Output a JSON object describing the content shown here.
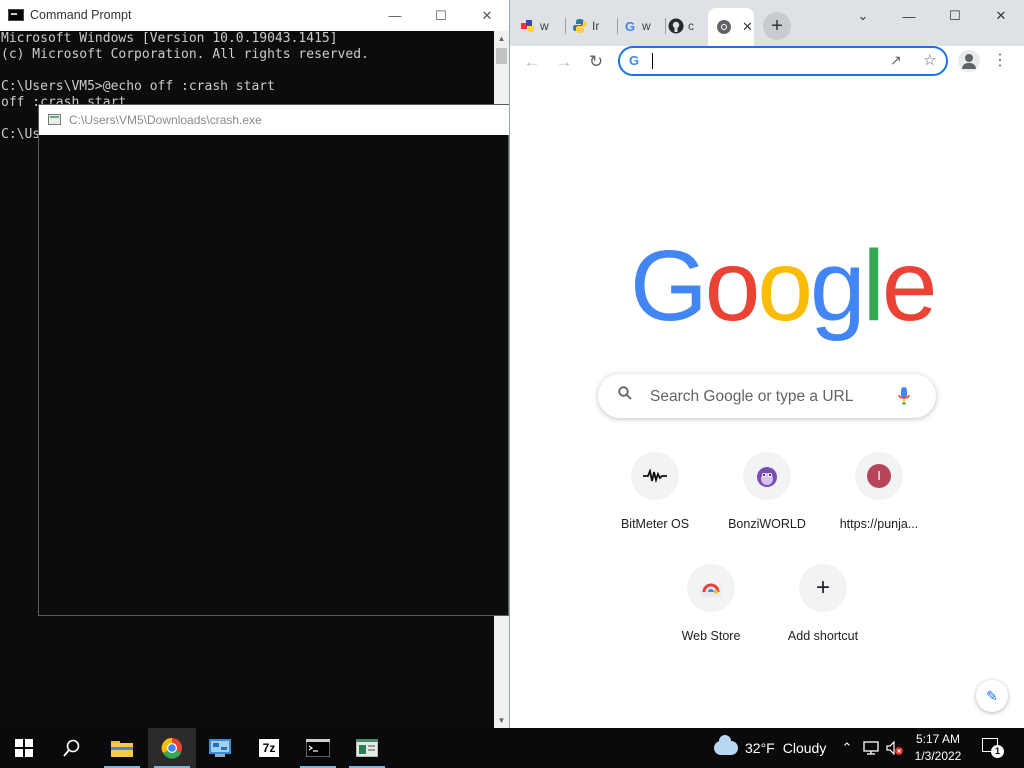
{
  "cmd": {
    "title": "Command Prompt",
    "lines": [
      "Microsoft Windows [Version 10.0.19043.1415]",
      "(c) Microsoft Corporation. All rights reserved.",
      "",
      "C:\\Users\\VM5>@echo off :crash start",
      "off :crash start",
      "",
      "C:\\Us"
    ]
  },
  "crash_window": {
    "title": "C:\\Users\\VM5\\Downloads\\crash.exe"
  },
  "chrome": {
    "tabs": [
      {
        "fav_icon": "color-blocks-icon",
        "label": "w"
      },
      {
        "fav_icon": "python-icon",
        "label": "Ir"
      },
      {
        "fav_icon": "google-icon",
        "label": "w"
      },
      {
        "fav_icon": "github-icon",
        "label": "c"
      },
      {
        "fav_icon": "chrome-icon",
        "label": "",
        "active": true
      }
    ],
    "newtab_symbol": "+",
    "window_controls": {
      "minimize": "—",
      "maximize": "☐",
      "close": "✕",
      "down": "⌄"
    },
    "address_bar": {
      "value": "",
      "g_label": "G"
    },
    "logo_letters": [
      {
        "ch": "G",
        "color": "#4285f4"
      },
      {
        "ch": "o",
        "color": "#ea4335"
      },
      {
        "ch": "o",
        "color": "#fbbc05"
      },
      {
        "ch": "g",
        "color": "#4285f4"
      },
      {
        "ch": "l",
        "color": "#34a853"
      },
      {
        "ch": "e",
        "color": "#ea4335"
      }
    ],
    "search_placeholder": "Search Google or type a URL",
    "shortcuts": [
      {
        "label": "BitMeter OS",
        "icon": "waveform-icon"
      },
      {
        "label": "BonziWORLD",
        "icon": "purple-monkey-icon"
      },
      {
        "label": "https://punja...",
        "icon": "letter-i-icon",
        "letter": "I"
      },
      {
        "label": "Web Store",
        "icon": "chrome-web-store-icon"
      },
      {
        "label": "Add shortcut",
        "icon": "plus-icon",
        "symbol": "+"
      }
    ]
  },
  "taskbar": {
    "pinned": [
      {
        "name": "file-explorer-icon"
      },
      {
        "name": "chrome-icon",
        "active": true
      },
      {
        "name": "control-panel-icon"
      },
      {
        "name": "7zip-icon",
        "text": "7z"
      },
      {
        "name": "cmd-icon"
      },
      {
        "name": "crash-exe-icon"
      }
    ],
    "weather": {
      "temp": "32°F",
      "condition": "Cloudy"
    },
    "clock": {
      "time": "5:17 AM",
      "date": "1/3/2022"
    },
    "notification_count": "1"
  },
  "colors": {
    "console_bg": "#0c0c0c",
    "console_fg": "#cccccc",
    "chrome_accent": "#1a73e8",
    "tabstrip_bg": "#dee1e6",
    "taskbar_bg": "#0a0a0a"
  }
}
